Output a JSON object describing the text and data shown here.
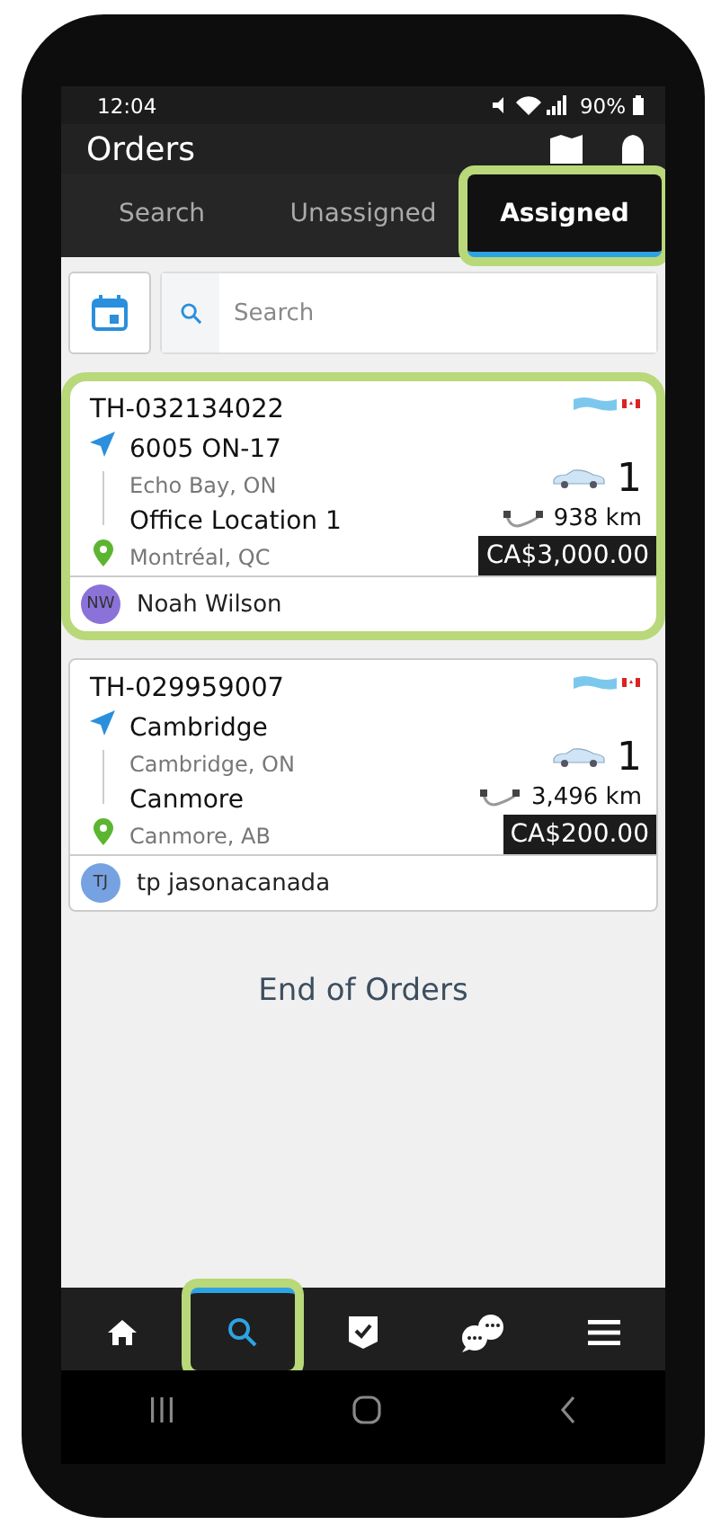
{
  "status_bar": {
    "time": "12:04",
    "battery": "90%"
  },
  "app_bar": {
    "title": "Orders"
  },
  "tabs": [
    {
      "label": "Search",
      "selected": false,
      "highlighted": false
    },
    {
      "label": "Unassigned",
      "selected": false,
      "highlighted": false
    },
    {
      "label": "Assigned",
      "selected": true,
      "highlighted": true
    }
  ],
  "search": {
    "placeholder": "Search"
  },
  "orders": [
    {
      "id": "TH-032134022",
      "pickup": {
        "name": "6005 ON-17",
        "city": "Echo Bay, ON"
      },
      "dropoff": {
        "name": "Office Location 1",
        "city": "Montréal, QC"
      },
      "vehicles": "1",
      "distance": "938 km",
      "price": "CA$3,000.00",
      "assignee": {
        "initials": "NW",
        "name": "Noah Wilson",
        "color": "#8b72d8"
      },
      "highlighted": true
    },
    {
      "id": "TH-029959007",
      "pickup": {
        "name": "Cambridge",
        "city": "Cambridge, ON"
      },
      "dropoff": {
        "name": "Canmore",
        "city": "Canmore, AB"
      },
      "vehicles": "1",
      "distance": "3,496 km",
      "price": "CA$200.00",
      "assignee": {
        "initials": "TJ",
        "name": "tp jasonacanada",
        "color": "#76a2e2"
      },
      "highlighted": false
    }
  ],
  "end_message": "End of Orders",
  "bottom_nav": [
    {
      "kind": "home",
      "selected": false,
      "highlighted": false
    },
    {
      "kind": "search",
      "selected": true,
      "highlighted": true
    },
    {
      "kind": "check",
      "selected": false,
      "highlighted": false
    },
    {
      "kind": "chat",
      "selected": false,
      "highlighted": false
    },
    {
      "kind": "menu",
      "selected": false,
      "highlighted": false
    }
  ]
}
